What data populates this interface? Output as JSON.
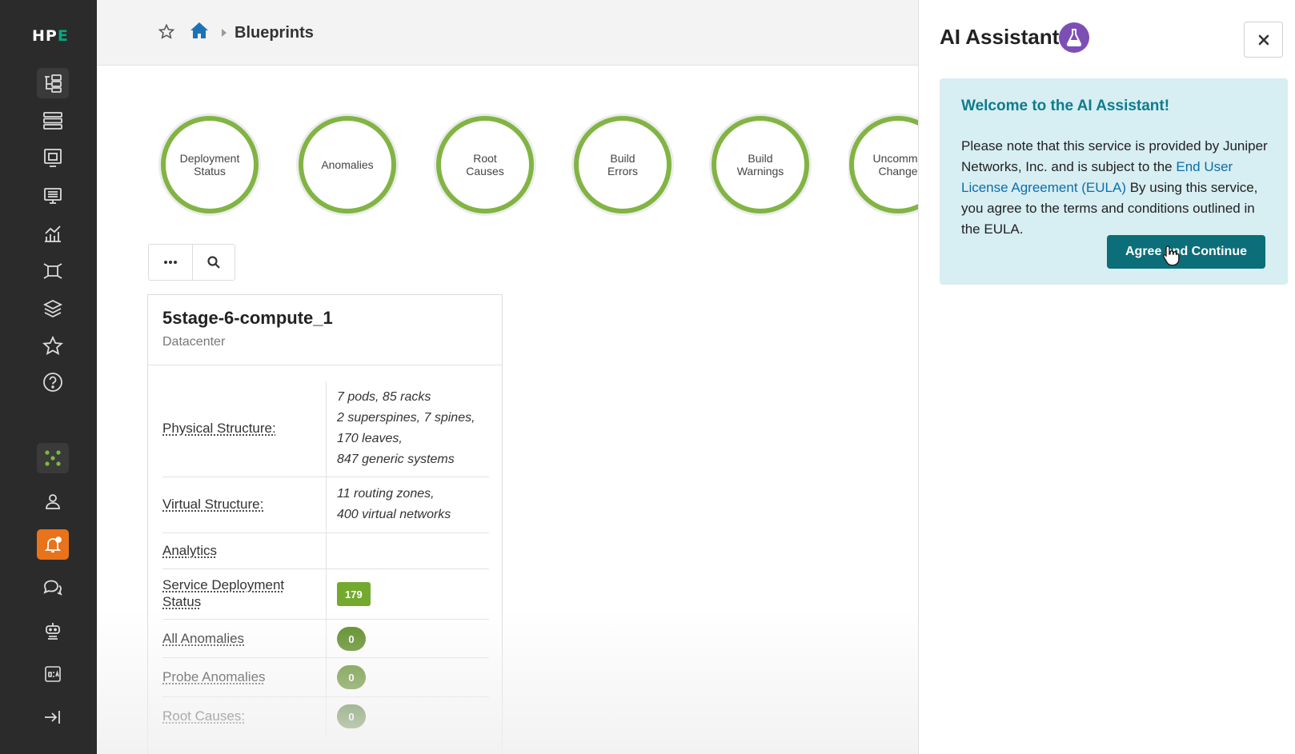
{
  "sidebar": {
    "logo_main": "HP",
    "logo_accent": "E",
    "items": [
      {
        "icon": "blueprints-icon"
      },
      {
        "icon": "devices-icon"
      },
      {
        "icon": "design-icon"
      },
      {
        "icon": "resources-icon"
      },
      {
        "icon": "analytics-icon"
      },
      {
        "icon": "external-systems-icon"
      },
      {
        "icon": "layers-icon"
      },
      {
        "icon": "favorites-icon"
      },
      {
        "icon": "help-icon"
      },
      {
        "icon": "platform-icon"
      },
      {
        "icon": "user-icon"
      },
      {
        "icon": "alerts-icon"
      },
      {
        "icon": "chat-icon"
      },
      {
        "icon": "robot-icon"
      },
      {
        "icon": "dca-icon"
      },
      {
        "icon": "collapse-icon"
      }
    ]
  },
  "header": {
    "breadcrumb": "Blueprints"
  },
  "status_circles": [
    {
      "line1": "Deployment",
      "line2": "Status"
    },
    {
      "line1": "Anomalies",
      "line2": ""
    },
    {
      "line1": "Root",
      "line2": "Causes"
    },
    {
      "line1": "Build",
      "line2": "Errors"
    },
    {
      "line1": "Build",
      "line2": "Warnings"
    },
    {
      "line1": "Uncommit",
      "line2": "Change"
    }
  ],
  "toolbar": {
    "more_icon": "more-icon",
    "search_icon": "search-icon"
  },
  "blueprint": {
    "name": "5stage-6-compute_1",
    "type": "Datacenter",
    "rows": {
      "physical_label": "Physical Structure:",
      "physical_lines": [
        "7 pods, 85 racks",
        "2 superspines, 7 spines,",
        "170 leaves,",
        "847 generic systems"
      ],
      "virtual_label": "Virtual Structure:",
      "virtual_lines": [
        "11 routing zones,",
        "400 virtual networks"
      ],
      "analytics_label": "Analytics",
      "service_label_1": "Service Deployment",
      "service_label_2": "Status",
      "service_value": "179",
      "anomalies_label": "All Anomalies",
      "anomalies_value": "0",
      "probe_label": "Probe Anomalies",
      "probe_value": "0",
      "root_label": "Root Causes:",
      "root_value": "0"
    }
  },
  "ai_panel": {
    "title": "AI Assistant",
    "welcome_title": "Welcome to the AI Assistant!",
    "body_1": "Please note that this service is provided by Juniper Networks, Inc. and is subject to the ",
    "link": "End User License Agreement (EULA)",
    "body_2": " By using this service, you agree to the terms and conditions outlined in the EULA.",
    "agree_label": "Agree and Continue"
  },
  "colors": {
    "sidebar_bg": "#2b2b2b",
    "ring_green": "#82b443",
    "badge_green": "#5a8a21",
    "alert_orange": "#e8731a",
    "ai_purple": "#7d4fb5",
    "welcome_bg": "#d7eef2",
    "agree_teal": "#0b6e78"
  }
}
